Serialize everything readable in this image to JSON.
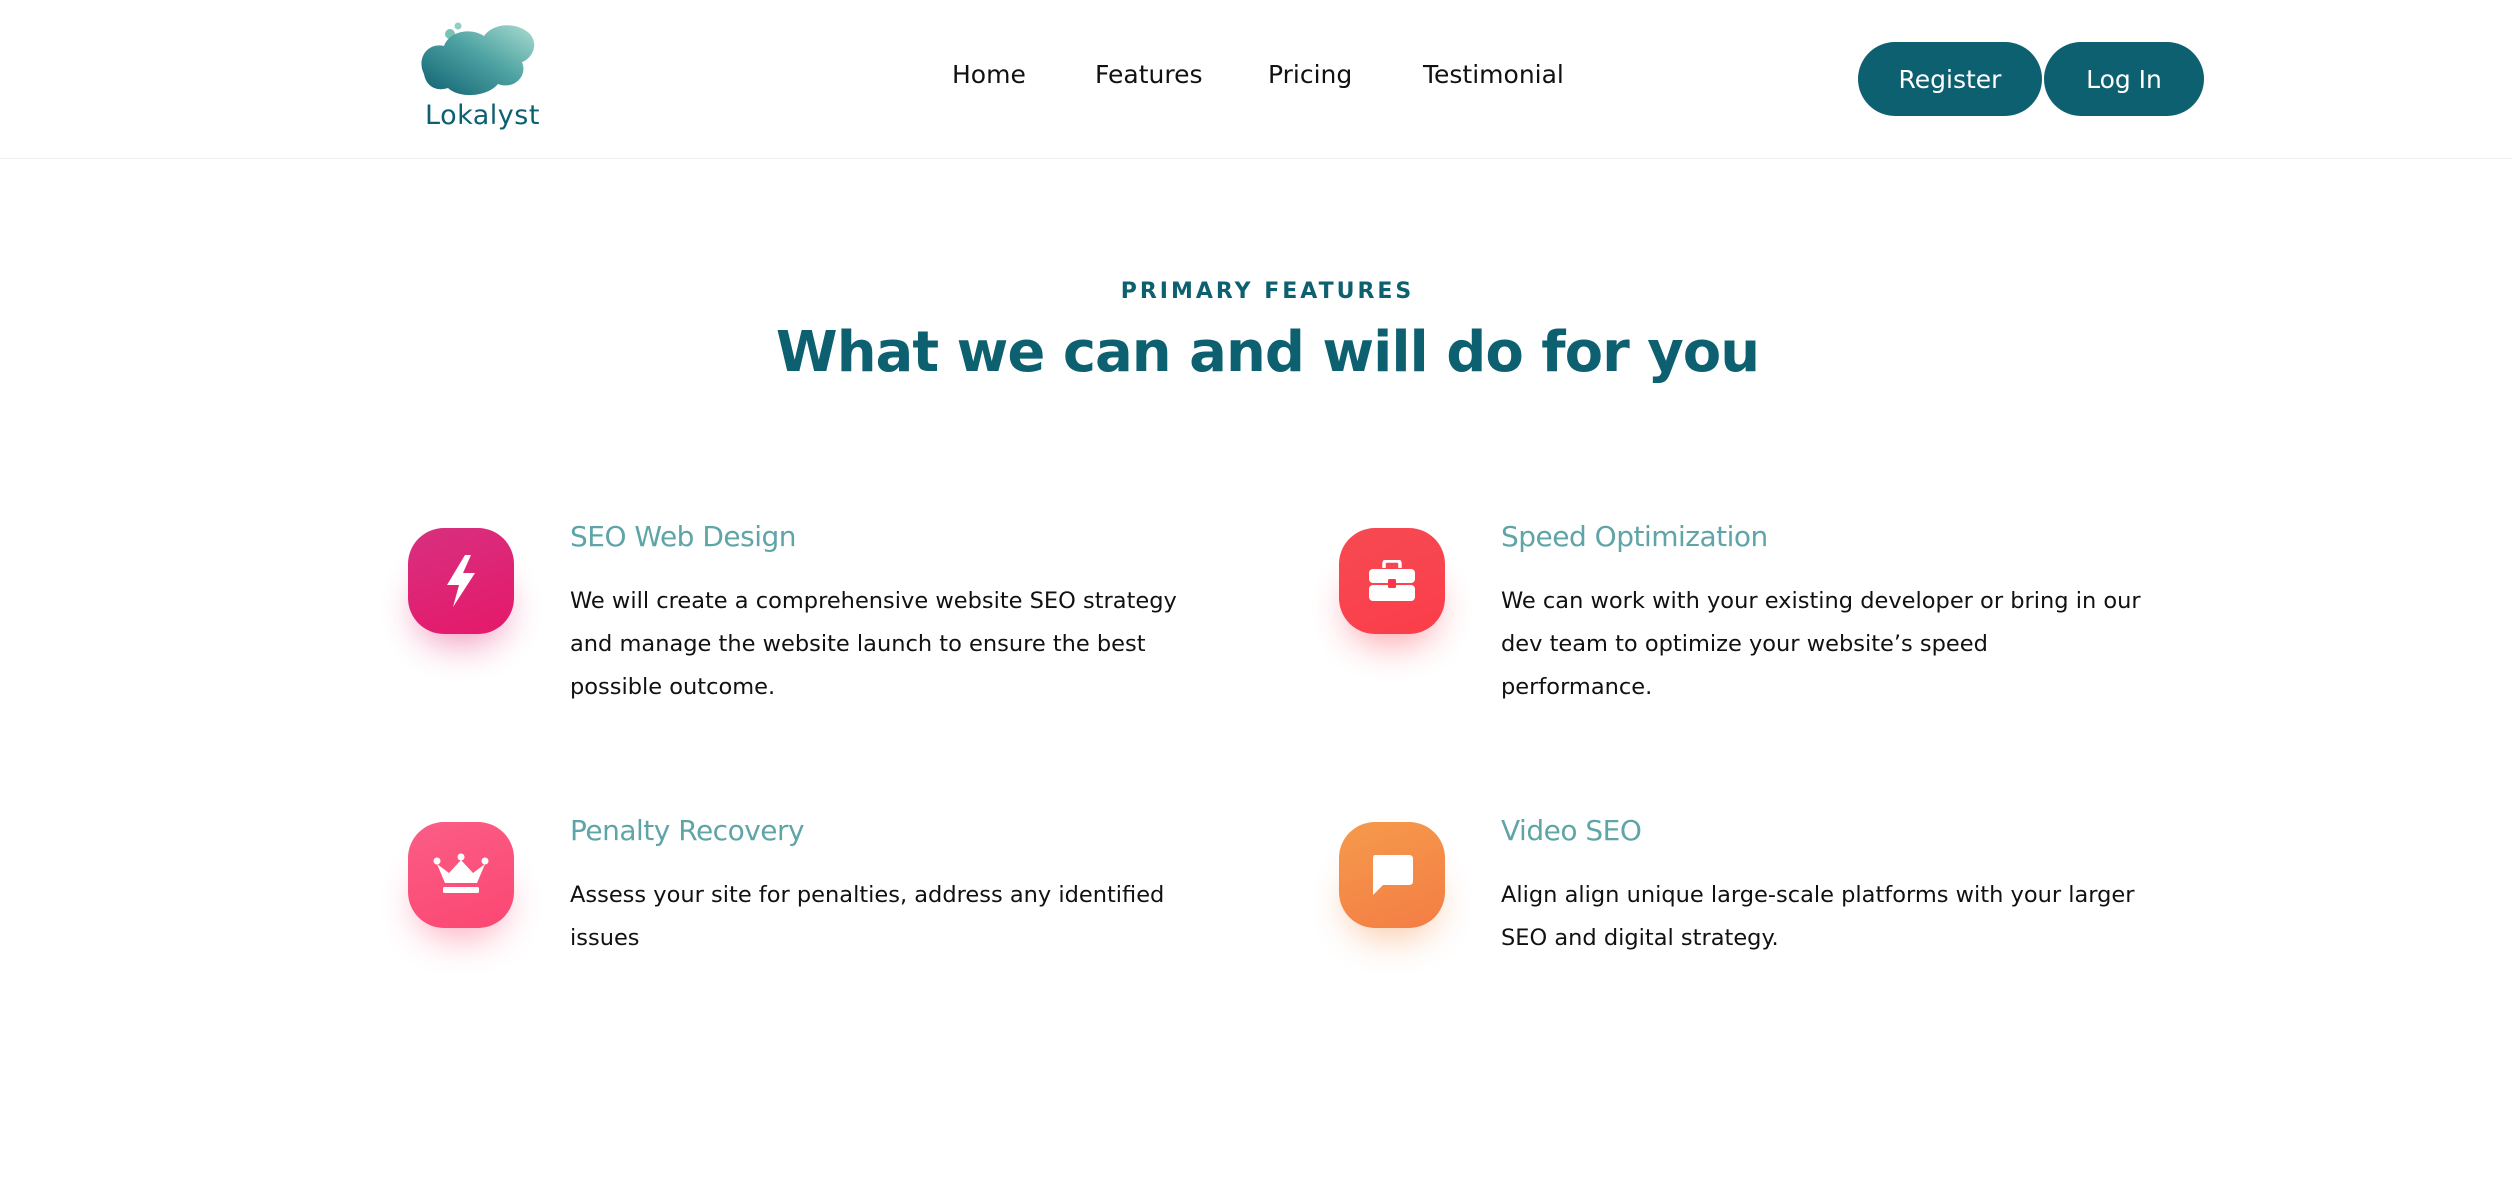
{
  "brand": {
    "name": "Lokalyst"
  },
  "nav": {
    "items": [
      {
        "label": "Home"
      },
      {
        "label": "Features"
      },
      {
        "label": "Pricing"
      },
      {
        "label": "Testimonial"
      }
    ]
  },
  "auth": {
    "register_label": "Register",
    "login_label": "Log In"
  },
  "section": {
    "eyebrow": "PRIMARY FEATURES",
    "title": "What we can and will do for you"
  },
  "features": [
    {
      "title": "SEO Web Design",
      "description": "We will create a comprehensive website SEO strategy and manage the website launch to ensure the best possible outcome.",
      "icon": "lightning-bolt-icon",
      "color": "#e0206e"
    },
    {
      "title": "Speed Optimization",
      "description": "We can work with your existing developer or bring in our dev team to optimize your website’s speed performance.",
      "icon": "briefcase-icon",
      "color": "#f8384a"
    },
    {
      "title": "Penalty Recovery",
      "description": "Assess your site for penalties, address any identified issues",
      "icon": "crown-icon",
      "color": "#fb4f78"
    },
    {
      "title": "Video SEO",
      "description": "Align align unique large-scale platforms with your larger SEO and digital strategy.",
      "icon": "chat-bubble-icon",
      "color": "#f58a45"
    }
  ],
  "colors": {
    "primary": "#0d6070",
    "feature_title": "#5fa5a8"
  }
}
